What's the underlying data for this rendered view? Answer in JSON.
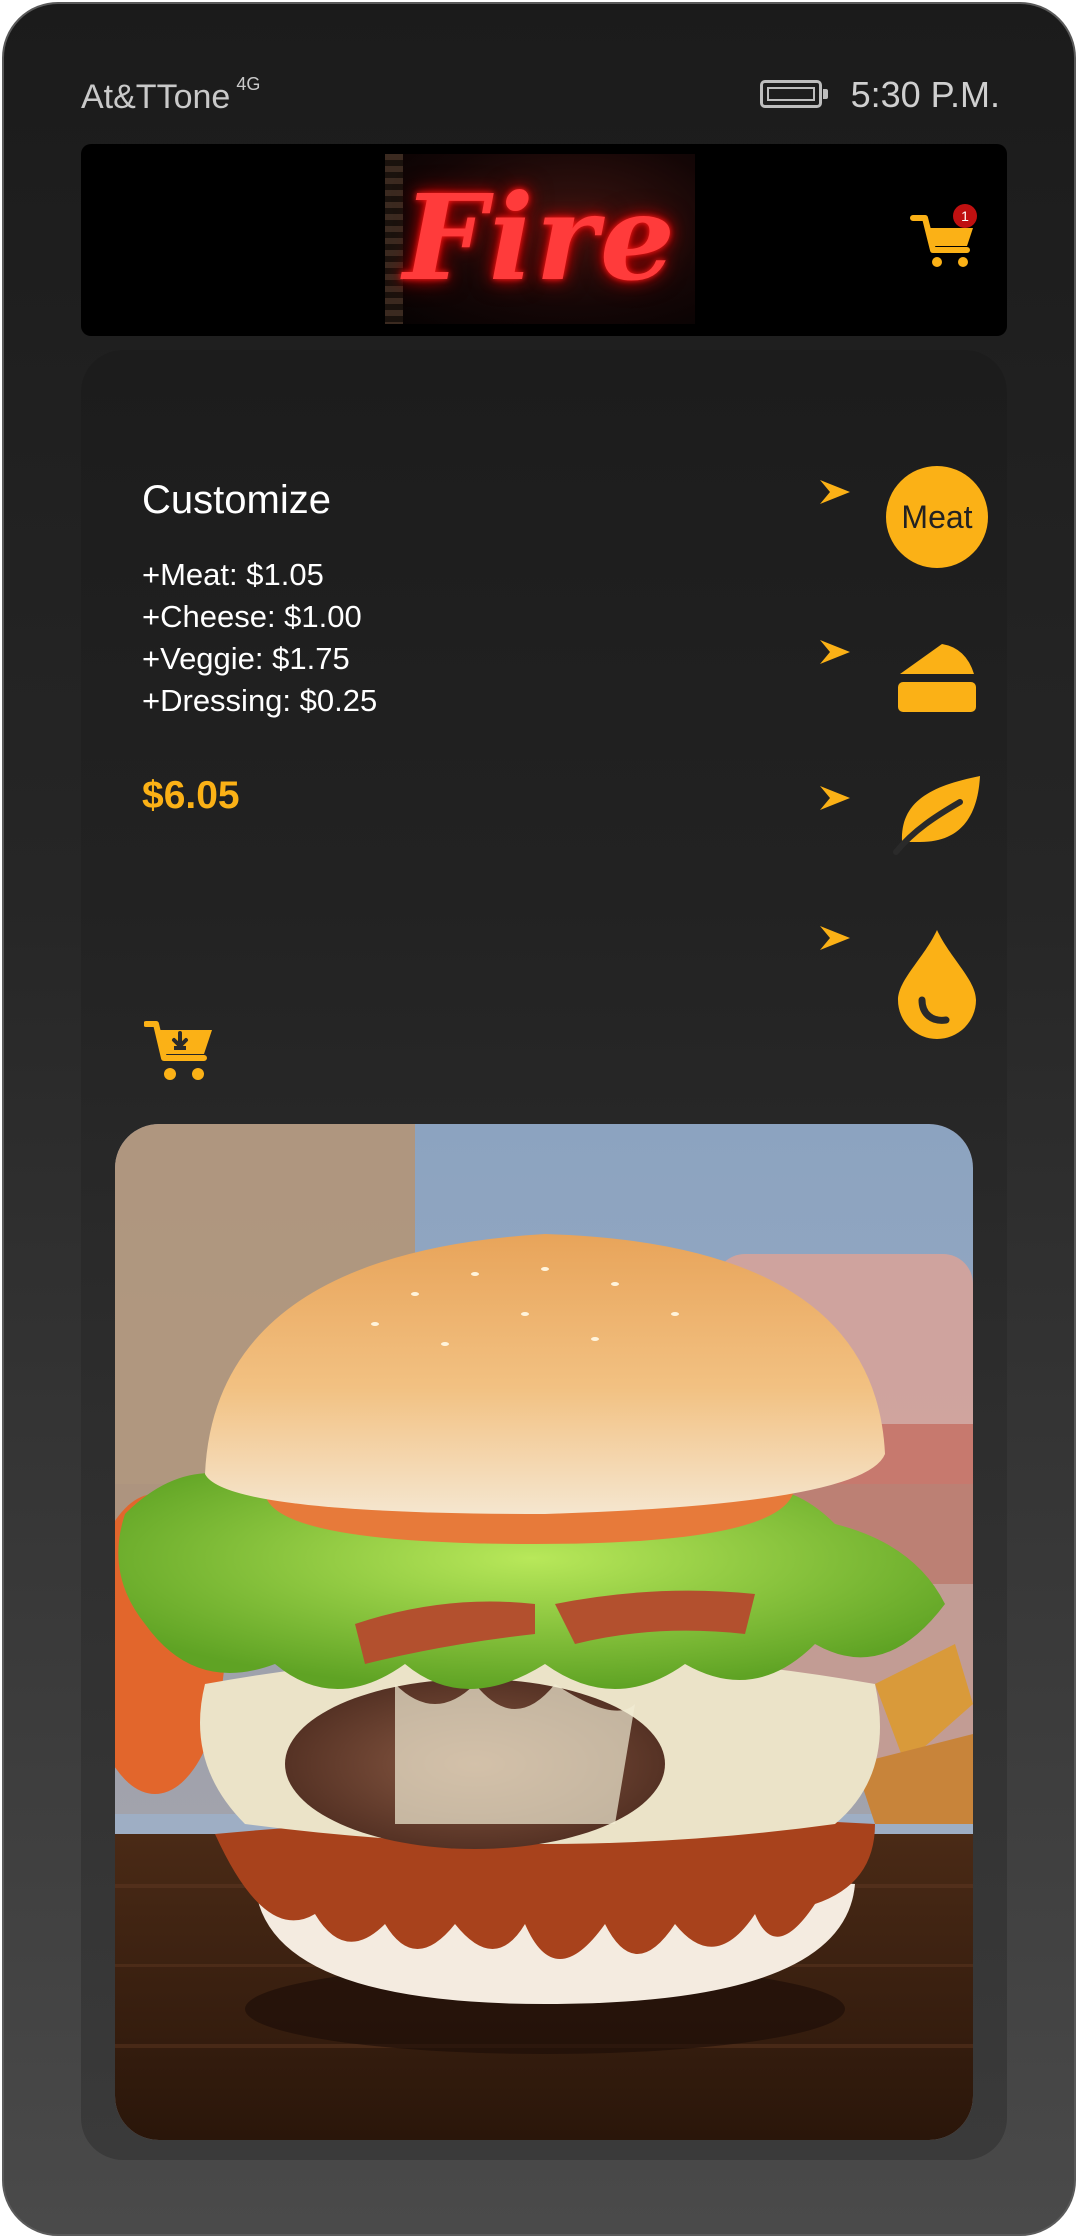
{
  "status_bar": {
    "carrier": "At&TTone",
    "network": "4G",
    "time": "5:30 P.M."
  },
  "header": {
    "logo_text": "Fire",
    "cart_count": "1"
  },
  "customize": {
    "title": "Customize",
    "options": [
      {
        "label": "+Meat: $1.05"
      },
      {
        "label": "+Cheese: $1.00"
      },
      {
        "label": "+Veggie: $1.75"
      },
      {
        "label": "+Dressing: $0.25"
      }
    ],
    "total": "$6.05"
  },
  "option_buttons": {
    "meat_label": "Meat",
    "cheese_icon": "cheese-icon",
    "veggie_icon": "leaf-icon",
    "dressing_icon": "drop-icon"
  },
  "colors": {
    "accent": "#fbb116",
    "background": "#1b1b1b",
    "logo_neon": "#ff3b3b",
    "badge": "#c01010"
  }
}
